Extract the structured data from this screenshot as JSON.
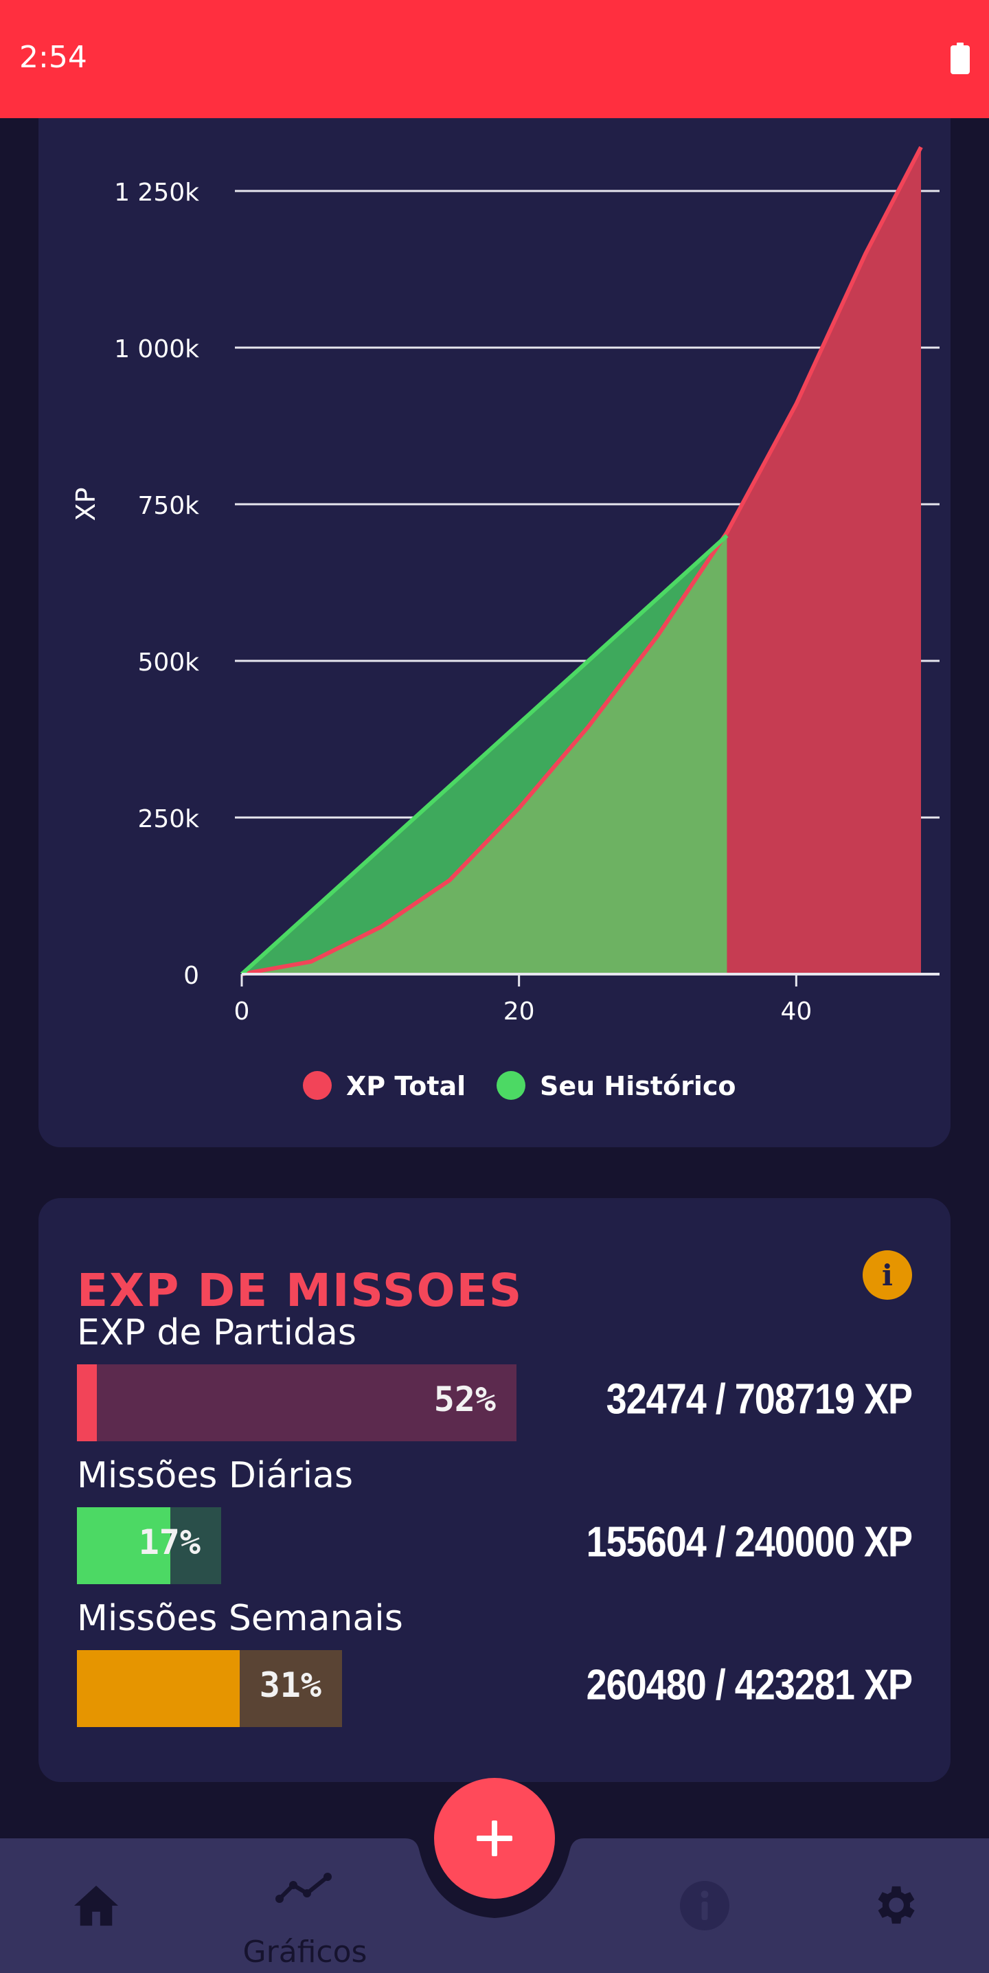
{
  "status_bar": {
    "time": "2:54"
  },
  "chart_data": {
    "type": "area",
    "ylabel": "XP",
    "xlabel": "",
    "xlim": [
      0,
      49
    ],
    "ylim": [
      0,
      1250000
    ],
    "y_ticks": [
      0,
      250000,
      500000,
      750000,
      1000000,
      1250000
    ],
    "y_tick_labels": [
      "0",
      "250k",
      "500k",
      "750k",
      "1 000k",
      "1 250k"
    ],
    "x_ticks": [
      0,
      20,
      40
    ],
    "x_tick_labels": [
      "0",
      "20",
      "40"
    ],
    "grid": true,
    "legend_position": "bottom",
    "series": [
      {
        "name": "XP Total",
        "color": "#f24458",
        "x": [
          0,
          5,
          10,
          15,
          20,
          25,
          30,
          35,
          40,
          45,
          49
        ],
        "values": [
          0,
          20000,
          75000,
          150000,
          265000,
          395000,
          540000,
          705000,
          910000,
          1150000,
          1320000
        ]
      },
      {
        "name": "Seu Histórico",
        "color": "#4cd964",
        "x": [
          0,
          35
        ],
        "values": [
          0,
          700000
        ]
      }
    ]
  },
  "missions": {
    "title": "EXP DE MISSOES",
    "info_icon": "info-icon",
    "rows": [
      {
        "label": "EXP de Partidas",
        "percent_text": "52%",
        "fill_fraction": 0.046,
        "track_fraction": 0.494,
        "fill_color": "#f24458",
        "track_color": "#5c2a4e",
        "value": "32474 / 708719 XP"
      },
      {
        "label": "Missões Diárias",
        "percent_text": "17%",
        "fill_fraction": 0.648,
        "track_fraction": 0.162,
        "fill_color": "#4cd964",
        "track_color": "#2a4f4a",
        "value": "155604 / 240000 XP"
      },
      {
        "label": "Missões Semanais",
        "percent_text": "31%",
        "fill_fraction": 0.615,
        "track_fraction": 0.298,
        "fill_color": "#e69500",
        "track_color": "#5a4434",
        "value": "260480 / 423281 XP"
      }
    ]
  },
  "fab": {
    "label": "+"
  },
  "nav": {
    "items": [
      {
        "icon": "home-icon",
        "label": ""
      },
      {
        "icon": "chart-line-icon",
        "label": "Gráficos"
      },
      {
        "icon": "info-circle-icon",
        "label": ""
      },
      {
        "icon": "gear-icon",
        "label": ""
      }
    ],
    "background": "#36335f"
  }
}
